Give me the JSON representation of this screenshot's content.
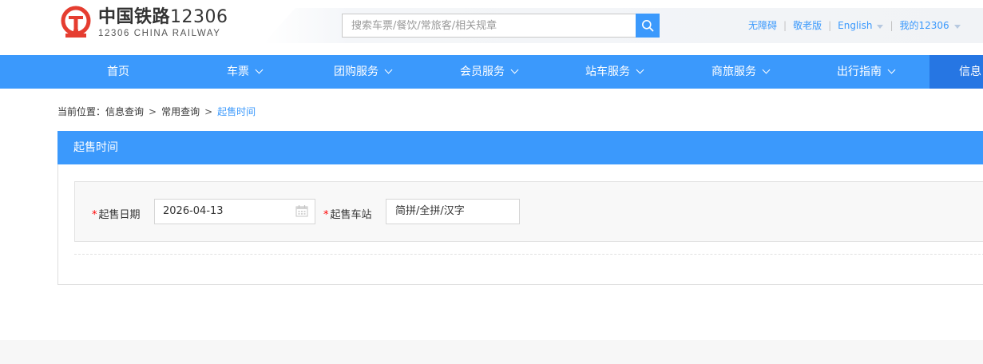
{
  "header": {
    "logo_cn_text": "中国铁路",
    "logo_cn_num": "12306",
    "logo_en": "12306 CHINA RAILWAY",
    "search_placeholder": "搜索车票/餐饮/常旅客/相关规章",
    "links": {
      "accessibility": "无障碍",
      "elderly": "敬老版",
      "english": "English",
      "my12306": "我的12306"
    }
  },
  "nav": {
    "items": [
      {
        "label": "首页"
      },
      {
        "label": "车票"
      },
      {
        "label": "团购服务"
      },
      {
        "label": "会员服务"
      },
      {
        "label": "站车服务"
      },
      {
        "label": "商旅服务"
      },
      {
        "label": "出行指南"
      },
      {
        "label": "信息"
      }
    ]
  },
  "breadcrumb": {
    "prefix": "当前位置：",
    "items": [
      "信息查询",
      "常用查询"
    ],
    "current": "起售时间"
  },
  "panel": {
    "title": "起售时间",
    "form": {
      "date_label": "起售日期",
      "date_value": "2026-04-13",
      "station_label": "起售车站",
      "station_placeholder": "简拼/全拼/汉字"
    }
  },
  "colors": {
    "primary": "#3b99fc",
    "nav_active": "#2676e3",
    "logo_red": "#e53d30"
  }
}
